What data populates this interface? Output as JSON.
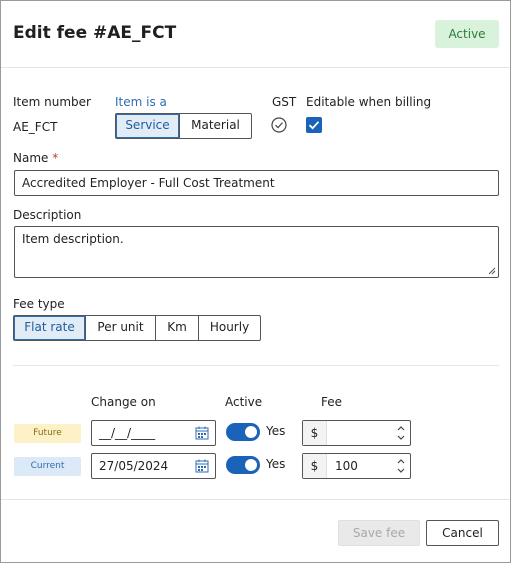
{
  "header": {
    "title": "Edit fee #AE_FCT",
    "status": "Active"
  },
  "item": {
    "number_label": "Item number",
    "number_value": "AE_FCT",
    "is_a_label": "Item is a",
    "types": [
      "Service",
      "Material"
    ],
    "selected_type": "Service",
    "gst_label": "GST",
    "editable_label": "Editable when billing"
  },
  "name": {
    "label": "Name",
    "required_mark": "*",
    "value": "Accredited Employer - Full Cost Treatment"
  },
  "description": {
    "label": "Description",
    "value": "Item description."
  },
  "fee_type": {
    "label": "Fee type",
    "options": [
      "Flat rate",
      "Per unit",
      "Km",
      "Hourly"
    ],
    "selected": "Flat rate"
  },
  "rates": {
    "headers": {
      "change_on": "Change on",
      "active": "Active",
      "fee": "Fee"
    },
    "rows": [
      {
        "badge": "Future",
        "badge_bg": "#fdf1c7",
        "badge_fg": "#8a6d12",
        "date": "__/__/____",
        "active_label": "Yes",
        "currency": "$",
        "fee": ""
      },
      {
        "badge": "Current",
        "badge_bg": "#dce9f7",
        "badge_fg": "#2f6db3",
        "date": "27/05/2024",
        "active_label": "Yes",
        "currency": "$",
        "fee": "100"
      }
    ]
  },
  "footer": {
    "save_label": "Save fee",
    "cancel_label": "Cancel"
  },
  "colors": {
    "accent": "#1a63b8",
    "active_badge_bg": "#d9f2dc",
    "active_badge_fg": "#2b7a37"
  }
}
